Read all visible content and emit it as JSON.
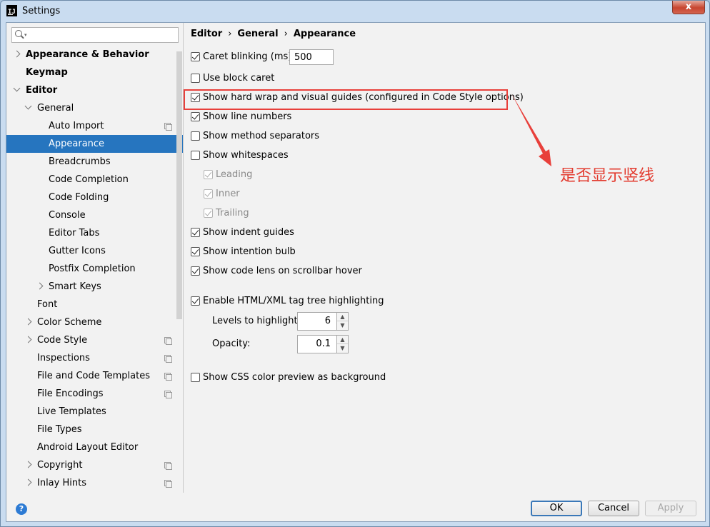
{
  "window": {
    "title": "Settings",
    "close_label": "x"
  },
  "search": {
    "placeholder": "",
    "value": ""
  },
  "sidebar": {
    "items": [
      {
        "label": "Appearance & Behavior",
        "bold": true,
        "chevron": "right",
        "copy": false
      },
      {
        "label": "Keymap",
        "bold": true,
        "chevron": "none",
        "copy": false
      },
      {
        "label": "Editor",
        "bold": true,
        "chevron": "down",
        "copy": false
      },
      {
        "label": "General",
        "bold": false,
        "chevron": "down",
        "copy": false
      },
      {
        "label": "Auto Import",
        "bold": false,
        "chevron": "none",
        "copy": true
      },
      {
        "label": "Appearance",
        "bold": false,
        "chevron": "none",
        "copy": false,
        "selected": true
      },
      {
        "label": "Breadcrumbs",
        "bold": false,
        "chevron": "none",
        "copy": false
      },
      {
        "label": "Code Completion",
        "bold": false,
        "chevron": "none",
        "copy": false
      },
      {
        "label": "Code Folding",
        "bold": false,
        "chevron": "none",
        "copy": false
      },
      {
        "label": "Console",
        "bold": false,
        "chevron": "none",
        "copy": false
      },
      {
        "label": "Editor Tabs",
        "bold": false,
        "chevron": "none",
        "copy": false
      },
      {
        "label": "Gutter Icons",
        "bold": false,
        "chevron": "none",
        "copy": false
      },
      {
        "label": "Postfix Completion",
        "bold": false,
        "chevron": "none",
        "copy": false
      },
      {
        "label": "Smart Keys",
        "bold": false,
        "chevron": "right",
        "copy": false
      },
      {
        "label": "Font",
        "bold": false,
        "chevron": "none",
        "copy": false
      },
      {
        "label": "Color Scheme",
        "bold": false,
        "chevron": "right",
        "copy": false
      },
      {
        "label": "Code Style",
        "bold": false,
        "chevron": "right",
        "copy": true
      },
      {
        "label": "Inspections",
        "bold": false,
        "chevron": "none",
        "copy": true
      },
      {
        "label": "File and Code Templates",
        "bold": false,
        "chevron": "none",
        "copy": true
      },
      {
        "label": "File Encodings",
        "bold": false,
        "chevron": "none",
        "copy": true
      },
      {
        "label": "Live Templates",
        "bold": false,
        "chevron": "none",
        "copy": false
      },
      {
        "label": "File Types",
        "bold": false,
        "chevron": "none",
        "copy": false
      },
      {
        "label": "Android Layout Editor",
        "bold": false,
        "chevron": "none",
        "copy": false
      },
      {
        "label": "Copyright",
        "bold": false,
        "chevron": "right",
        "copy": true
      },
      {
        "label": "Inlay Hints",
        "bold": false,
        "chevron": "right",
        "copy": true
      }
    ]
  },
  "breadcrumb": {
    "part1": "Editor",
    "sep": "›",
    "part2": "General",
    "part3": "Appearance"
  },
  "options": {
    "caret_blinking": {
      "label": "Caret blinking (ms):",
      "checked": true,
      "value": "500"
    },
    "block_caret": {
      "label": "Use block caret",
      "checked": false
    },
    "hard_wrap": {
      "label": "Show hard wrap and visual guides (configured in Code Style options)",
      "checked": true
    },
    "line_numbers": {
      "label": "Show line numbers",
      "checked": true
    },
    "method_separators": {
      "label": "Show method separators",
      "checked": false
    },
    "whitespaces": {
      "label": "Show whitespaces",
      "checked": false
    },
    "leading": {
      "label": "Leading",
      "checked": true,
      "disabled": true
    },
    "inner": {
      "label": "Inner",
      "checked": true,
      "disabled": true
    },
    "trailing": {
      "label": "Trailing",
      "checked": true,
      "disabled": true
    },
    "indent_guides": {
      "label": "Show indent guides",
      "checked": true
    },
    "intention_bulb": {
      "label": "Show intention bulb",
      "checked": true
    },
    "code_lens": {
      "label": "Show code lens on scrollbar hover",
      "checked": true
    },
    "tag_tree": {
      "label": "Enable HTML/XML tag tree highlighting",
      "checked": true
    },
    "levels": {
      "label": "Levels to highlight:",
      "value": "6"
    },
    "opacity": {
      "label": "Opacity:",
      "value": "0.1"
    },
    "css_preview": {
      "label": "Show CSS color preview as background",
      "checked": false
    }
  },
  "annotation": {
    "text": "是否显示竖线",
    "color": "#e33b2f"
  },
  "buttons": {
    "ok": "OK",
    "cancel": "Cancel",
    "apply": "Apply"
  },
  "help": {
    "label": "?"
  },
  "colors": {
    "selection": "#2675bf",
    "highlight_box": "#e8403b"
  }
}
